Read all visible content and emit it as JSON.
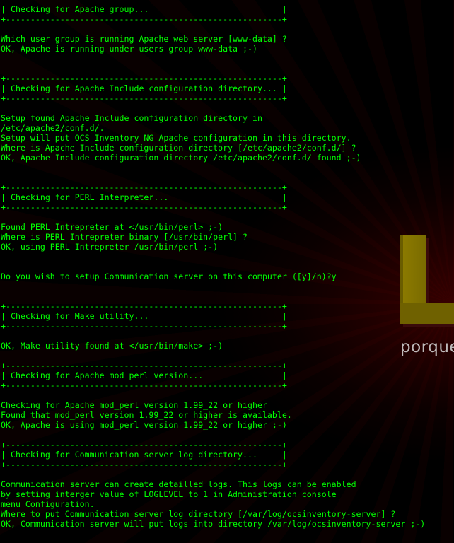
{
  "colors": {
    "terminal_background": "#000000",
    "terminal_text": "#00ff00",
    "logo_letter": "#7a6b00",
    "logo_text": "#cfcfcf",
    "background_rays": "#5a0000"
  },
  "wallpaper": {
    "logo_letter": "L",
    "logo_text": "porque"
  },
  "terminal": {
    "lines": [
      "| Checking for Apache group...                           |",
      "+--------------------------------------------------------+",
      "",
      "Which user group is running Apache web server [www-data] ?",
      "OK, Apache is running under users group www-data ;-)",
      "",
      "",
      "+--------------------------------------------------------+",
      "| Checking for Apache Include configuration directory... |",
      "+--------------------------------------------------------+",
      "",
      "Setup found Apache Include configuration directory in",
      "/etc/apache2/conf.d/.",
      "Setup will put OCS Inventory NG Apache configuration in this directory.",
      "Where is Apache Include configuration directory [/etc/apache2/conf.d/] ?",
      "OK, Apache Include configuration directory /etc/apache2/conf.d/ found ;-)",
      "",
      "",
      "+--------------------------------------------------------+",
      "| Checking for PERL Interpreter...                       |",
      "+--------------------------------------------------------+",
      "",
      "Found PERL Intrepreter at </usr/bin/perl> ;-)",
      "Where is PERL Intrepreter binary [/usr/bin/perl] ?",
      "OK, using PERL Intrepreter /usr/bin/perl ;-)",
      "",
      "",
      "Do you wish to setup Communication server on this computer ([y]/n)?y",
      "",
      "",
      "+--------------------------------------------------------+",
      "| Checking for Make utility...                           |",
      "+--------------------------------------------------------+",
      "",
      "OK, Make utility found at </usr/bin/make> ;-)",
      "",
      "+--------------------------------------------------------+",
      "| Checking for Apache mod_perl version...                |",
      "+--------------------------------------------------------+",
      "",
      "Checking for Apache mod_perl version 1.99_22 or higher",
      "Found that mod_perl version 1.99_22 or higher is available.",
      "OK, Apache is using mod_perl version 1.99_22 or higher ;-)",
      "",
      "+--------------------------------------------------------+",
      "| Checking for Communication server log directory...     |",
      "+--------------------------------------------------------+",
      "",
      "Communication server can create detailled logs. This logs can be enabled",
      "by setting interger value of LOGLEVEL to 1 in Administration console",
      "menu Configuration.",
      "Where to put Communication server log directory [/var/log/ocsinventory-server] ?",
      "OK, Communication server will put logs into directory /var/log/ocsinventory-server ;-)"
    ]
  }
}
